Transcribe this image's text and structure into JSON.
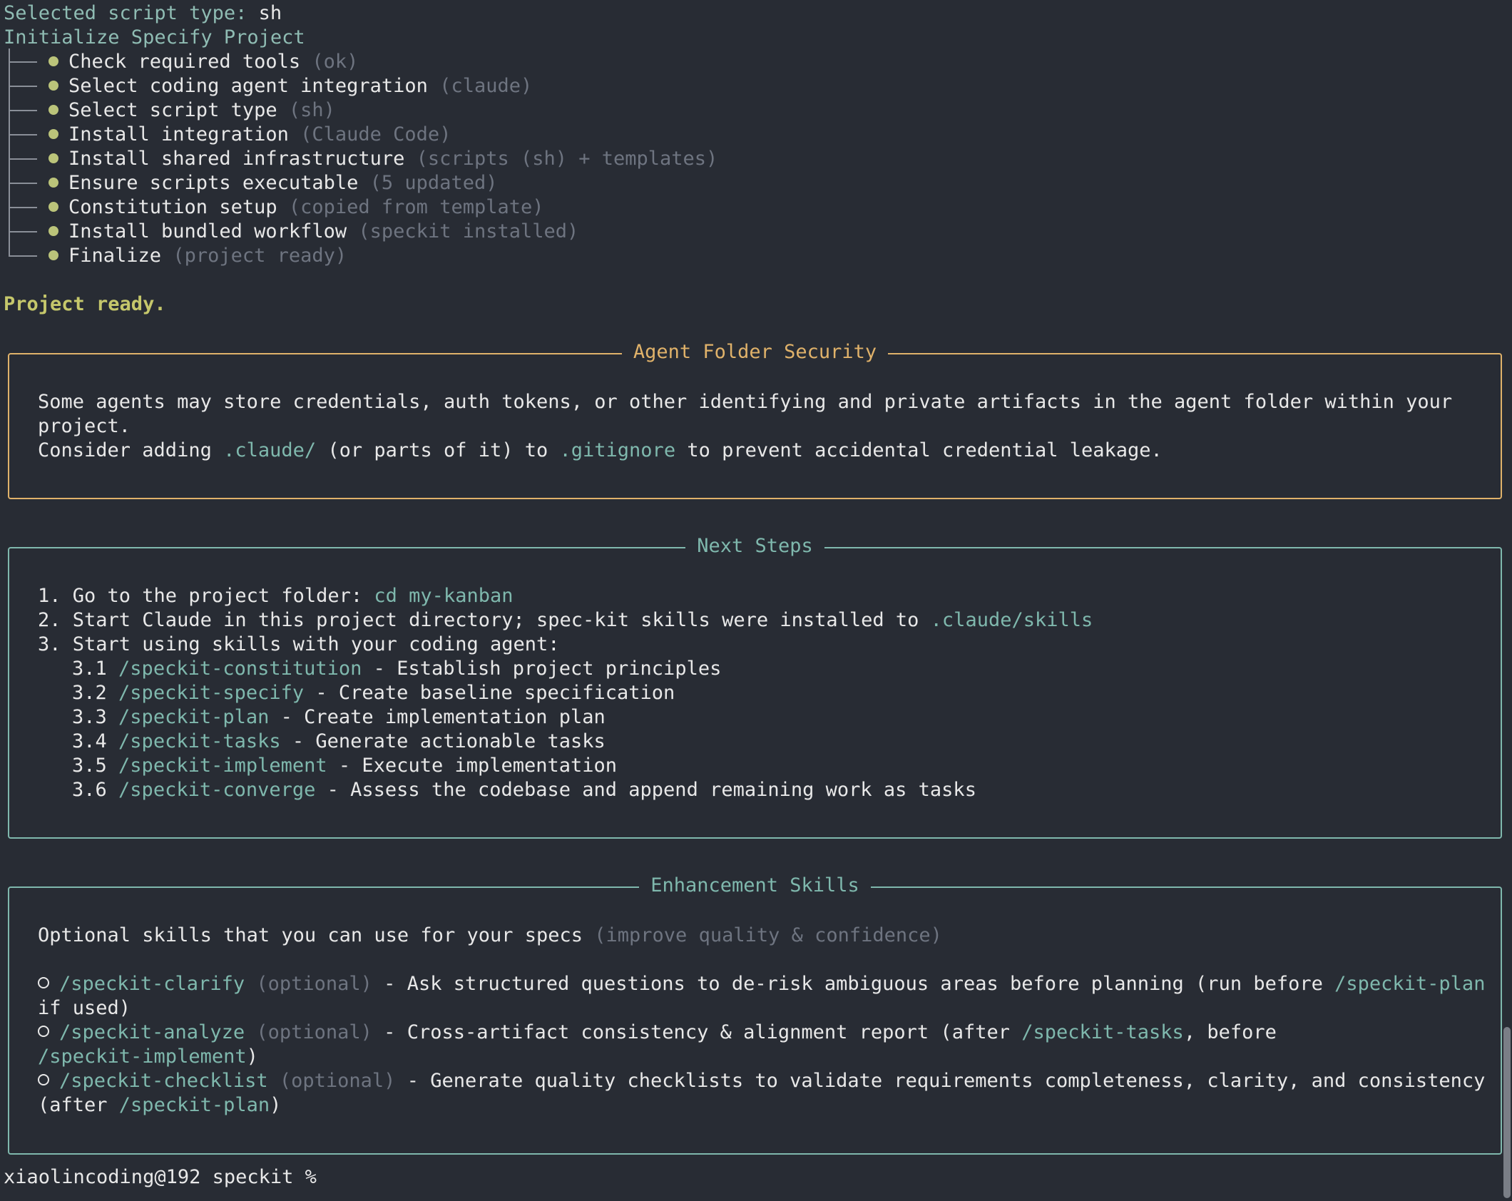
{
  "header": {
    "script_type_label": "Selected script type:",
    "script_type_value": "sh",
    "init_title": "Initialize Specify Project"
  },
  "steps": [
    {
      "label": "Check required tools",
      "detail": "(ok)"
    },
    {
      "label": "Select coding agent integration",
      "detail": "(claude)"
    },
    {
      "label": "Select script type",
      "detail": "(sh)"
    },
    {
      "label": "Install integration",
      "detail": "(Claude Code)"
    },
    {
      "label": "Install shared infrastructure",
      "detail": "(scripts (sh) + templates)"
    },
    {
      "label": "Ensure scripts executable",
      "detail": "(5 updated)"
    },
    {
      "label": "Constitution setup",
      "detail": "(copied from template)"
    },
    {
      "label": "Install bundled workflow",
      "detail": "(speckit installed)"
    },
    {
      "label": "Finalize",
      "detail": "(project ready)"
    }
  ],
  "status": "Project ready.",
  "security_panel": {
    "title": "Agent Folder Security",
    "line1": "Some agents may store credentials, auth tokens, or other identifying and private artifacts in the agent folder within your",
    "line2": "project.",
    "line3_a": "Consider adding ",
    "line3_path": ".claude/",
    "line3_b": " (or parts of it) to ",
    "line3_file": ".gitignore",
    "line3_c": " to prevent accidental credential leakage."
  },
  "next_steps": {
    "title": "Next Steps",
    "step1_text": "1. Go to the project folder: ",
    "step1_cmd": "cd my-kanban",
    "step2_text": "2. Start Claude in this project directory; spec-kit skills were installed to ",
    "step2_path": ".claude/skills",
    "step3_text": "3. Start using skills with your coding agent:",
    "skills": [
      {
        "num": "3.1",
        "cmd": "/speckit-constitution",
        "desc": " - Establish project principles"
      },
      {
        "num": "3.2",
        "cmd": "/speckit-specify",
        "desc": " - Create baseline specification"
      },
      {
        "num": "3.3",
        "cmd": "/speckit-plan",
        "desc": " - Create implementation plan"
      },
      {
        "num": "3.4",
        "cmd": "/speckit-tasks",
        "desc": " - Generate actionable tasks"
      },
      {
        "num": "3.5",
        "cmd": "/speckit-implement",
        "desc": " - Execute implementation"
      },
      {
        "num": "3.6",
        "cmd": "/speckit-converge",
        "desc": " - Assess the codebase and append remaining work as tasks"
      }
    ]
  },
  "enhancement": {
    "title": "Enhancement Skills",
    "intro": "Optional skills that you can use for your specs ",
    "intro_muted": "(improve quality & confidence)",
    "optional_tag": "(optional)",
    "clarify_cmd": "/speckit-clarify",
    "clarify_desc": " - Ask structured questions to de-risk ambiguous areas before planning (run before ",
    "clarify_ref": "/speckit-plan",
    "clarify_tail": "if used)",
    "analyze_cmd": "/speckit-analyze",
    "analyze_desc": " - Cross-artifact consistency & alignment report (after ",
    "analyze_ref1": "/speckit-tasks",
    "analyze_mid": ", before",
    "analyze_ref2": "/speckit-implement",
    "analyze_tail": ")",
    "checklist_cmd": "/speckit-checklist",
    "checklist_desc": " - Generate quality checklists to validate requirements completeness, clarity, and consistency",
    "checklist_pre": "(after ",
    "checklist_ref": "/speckit-plan",
    "checklist_tail": ")"
  },
  "prompt": "xiaolincoding@192 speckit %",
  "colors": {
    "background": "#282c34",
    "accent_teal": "#7fb8ad",
    "security_border": "#e0b26a",
    "panel_border": "#7fb8ad",
    "ready_yellow": "#c5c76b",
    "bullet_green": "#bbc47a"
  }
}
